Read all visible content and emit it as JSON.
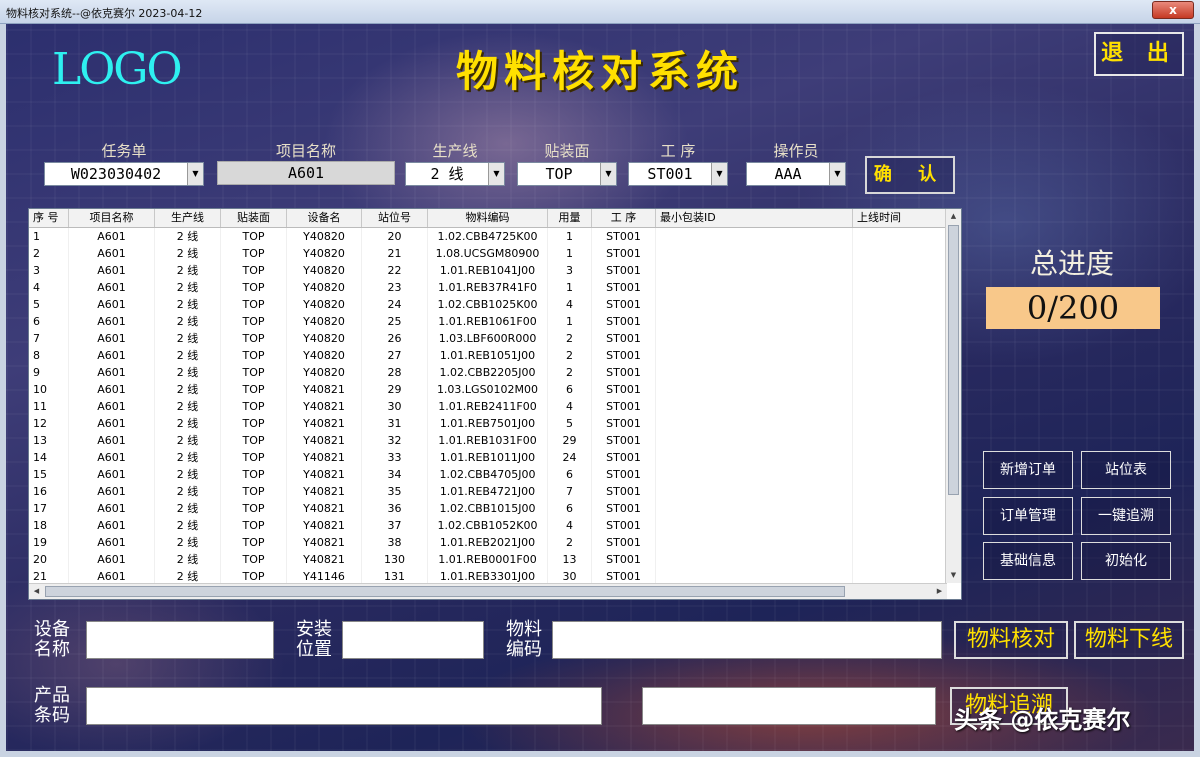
{
  "window": {
    "title": "物料核对系统--@依克赛尔 2023-04-12",
    "close_label": "x"
  },
  "header": {
    "logo": "LOGO",
    "title": "物料核对系统",
    "exit_label": "退 出"
  },
  "form": {
    "task_label": "任务单",
    "task_value": "W023030402",
    "project_label": "项目名称",
    "project_value": "A601",
    "line_label": "生产线",
    "line_value": "2 线",
    "surface_label": "贴装面",
    "surface_value": "TOP",
    "process_label": "工 序",
    "process_value": "ST001",
    "operator_label": "操作员",
    "operator_value": "AAA",
    "confirm_label": "确 认"
  },
  "table": {
    "columns": [
      "序 号",
      "项目名称",
      "生产线",
      "贴装面",
      "设备名",
      "站位号",
      "物料编码",
      "用量",
      "工 序",
      "最小包装ID",
      "上线时间"
    ],
    "rows": [
      [
        "1",
        "A601",
        "2 线",
        "TOP",
        "Y40820",
        "20",
        "1.02.CBB4725K00",
        "1",
        "ST001",
        "",
        ""
      ],
      [
        "2",
        "A601",
        "2 线",
        "TOP",
        "Y40820",
        "21",
        "1.08.UCSGM80900",
        "1",
        "ST001",
        "",
        ""
      ],
      [
        "3",
        "A601",
        "2 线",
        "TOP",
        "Y40820",
        "22",
        "1.01.REB1041J00",
        "3",
        "ST001",
        "",
        ""
      ],
      [
        "4",
        "A601",
        "2 线",
        "TOP",
        "Y40820",
        "23",
        "1.01.REB37R41F0",
        "1",
        "ST001",
        "",
        ""
      ],
      [
        "5",
        "A601",
        "2 线",
        "TOP",
        "Y40820",
        "24",
        "1.02.CBB1025K00",
        "4",
        "ST001",
        "",
        ""
      ],
      [
        "6",
        "A601",
        "2 线",
        "TOP",
        "Y40820",
        "25",
        "1.01.REB1061F00",
        "1",
        "ST001",
        "",
        ""
      ],
      [
        "7",
        "A601",
        "2 线",
        "TOP",
        "Y40820",
        "26",
        "1.03.LBF600R000",
        "2",
        "ST001",
        "",
        ""
      ],
      [
        "8",
        "A601",
        "2 线",
        "TOP",
        "Y40820",
        "27",
        "1.01.REB1051J00",
        "2",
        "ST001",
        "",
        ""
      ],
      [
        "9",
        "A601",
        "2 线",
        "TOP",
        "Y40820",
        "28",
        "1.02.CBB2205J00",
        "2",
        "ST001",
        "",
        ""
      ],
      [
        "10",
        "A601",
        "2 线",
        "TOP",
        "Y40821",
        "29",
        "1.03.LGS0102M00",
        "6",
        "ST001",
        "",
        ""
      ],
      [
        "11",
        "A601",
        "2 线",
        "TOP",
        "Y40821",
        "30",
        "1.01.REB2411F00",
        "4",
        "ST001",
        "",
        ""
      ],
      [
        "12",
        "A601",
        "2 线",
        "TOP",
        "Y40821",
        "31",
        "1.01.REB7501J00",
        "5",
        "ST001",
        "",
        ""
      ],
      [
        "13",
        "A601",
        "2 线",
        "TOP",
        "Y40821",
        "32",
        "1.01.REB1031F00",
        "29",
        "ST001",
        "",
        ""
      ],
      [
        "14",
        "A601",
        "2 线",
        "TOP",
        "Y40821",
        "33",
        "1.01.REB1011J00",
        "24",
        "ST001",
        "",
        ""
      ],
      [
        "15",
        "A601",
        "2 线",
        "TOP",
        "Y40821",
        "34",
        "1.02.CBB4705J00",
        "6",
        "ST001",
        "",
        ""
      ],
      [
        "16",
        "A601",
        "2 线",
        "TOP",
        "Y40821",
        "35",
        "1.01.REB4721J00",
        "7",
        "ST001",
        "",
        ""
      ],
      [
        "17",
        "A601",
        "2 线",
        "TOP",
        "Y40821",
        "36",
        "1.02.CBB1015J00",
        "6",
        "ST001",
        "",
        ""
      ],
      [
        "18",
        "A601",
        "2 线",
        "TOP",
        "Y40821",
        "37",
        "1.02.CBB1052K00",
        "4",
        "ST001",
        "",
        ""
      ],
      [
        "19",
        "A601",
        "2 线",
        "TOP",
        "Y40821",
        "38",
        "1.01.REB2021J00",
        "2",
        "ST001",
        "",
        ""
      ],
      [
        "20",
        "A601",
        "2 线",
        "TOP",
        "Y40821",
        "130",
        "1.01.REB0001F00",
        "13",
        "ST001",
        "",
        ""
      ],
      [
        "21",
        "A601",
        "2 线",
        "TOP",
        "Y41146",
        "131",
        "1.01.REB3301J00",
        "30",
        "ST001",
        "",
        ""
      ]
    ]
  },
  "progress": {
    "title": "总进度",
    "value": "0/200"
  },
  "side_buttons": {
    "new_order": "新增订单",
    "station_table": "站位表",
    "order_mgmt": "订单管理",
    "one_click_trace": "一键追溯",
    "basic_info": "基础信息",
    "init": "初始化"
  },
  "bottom": {
    "device_label": "设备名称",
    "install_label": "安装位置",
    "material_label": "物料编码",
    "product_label": "产品条码",
    "check_btn": "物料核对",
    "offline_btn": "物料下线",
    "trace_btn": "物料追溯"
  },
  "watermark": "头条 @依克赛尔"
}
